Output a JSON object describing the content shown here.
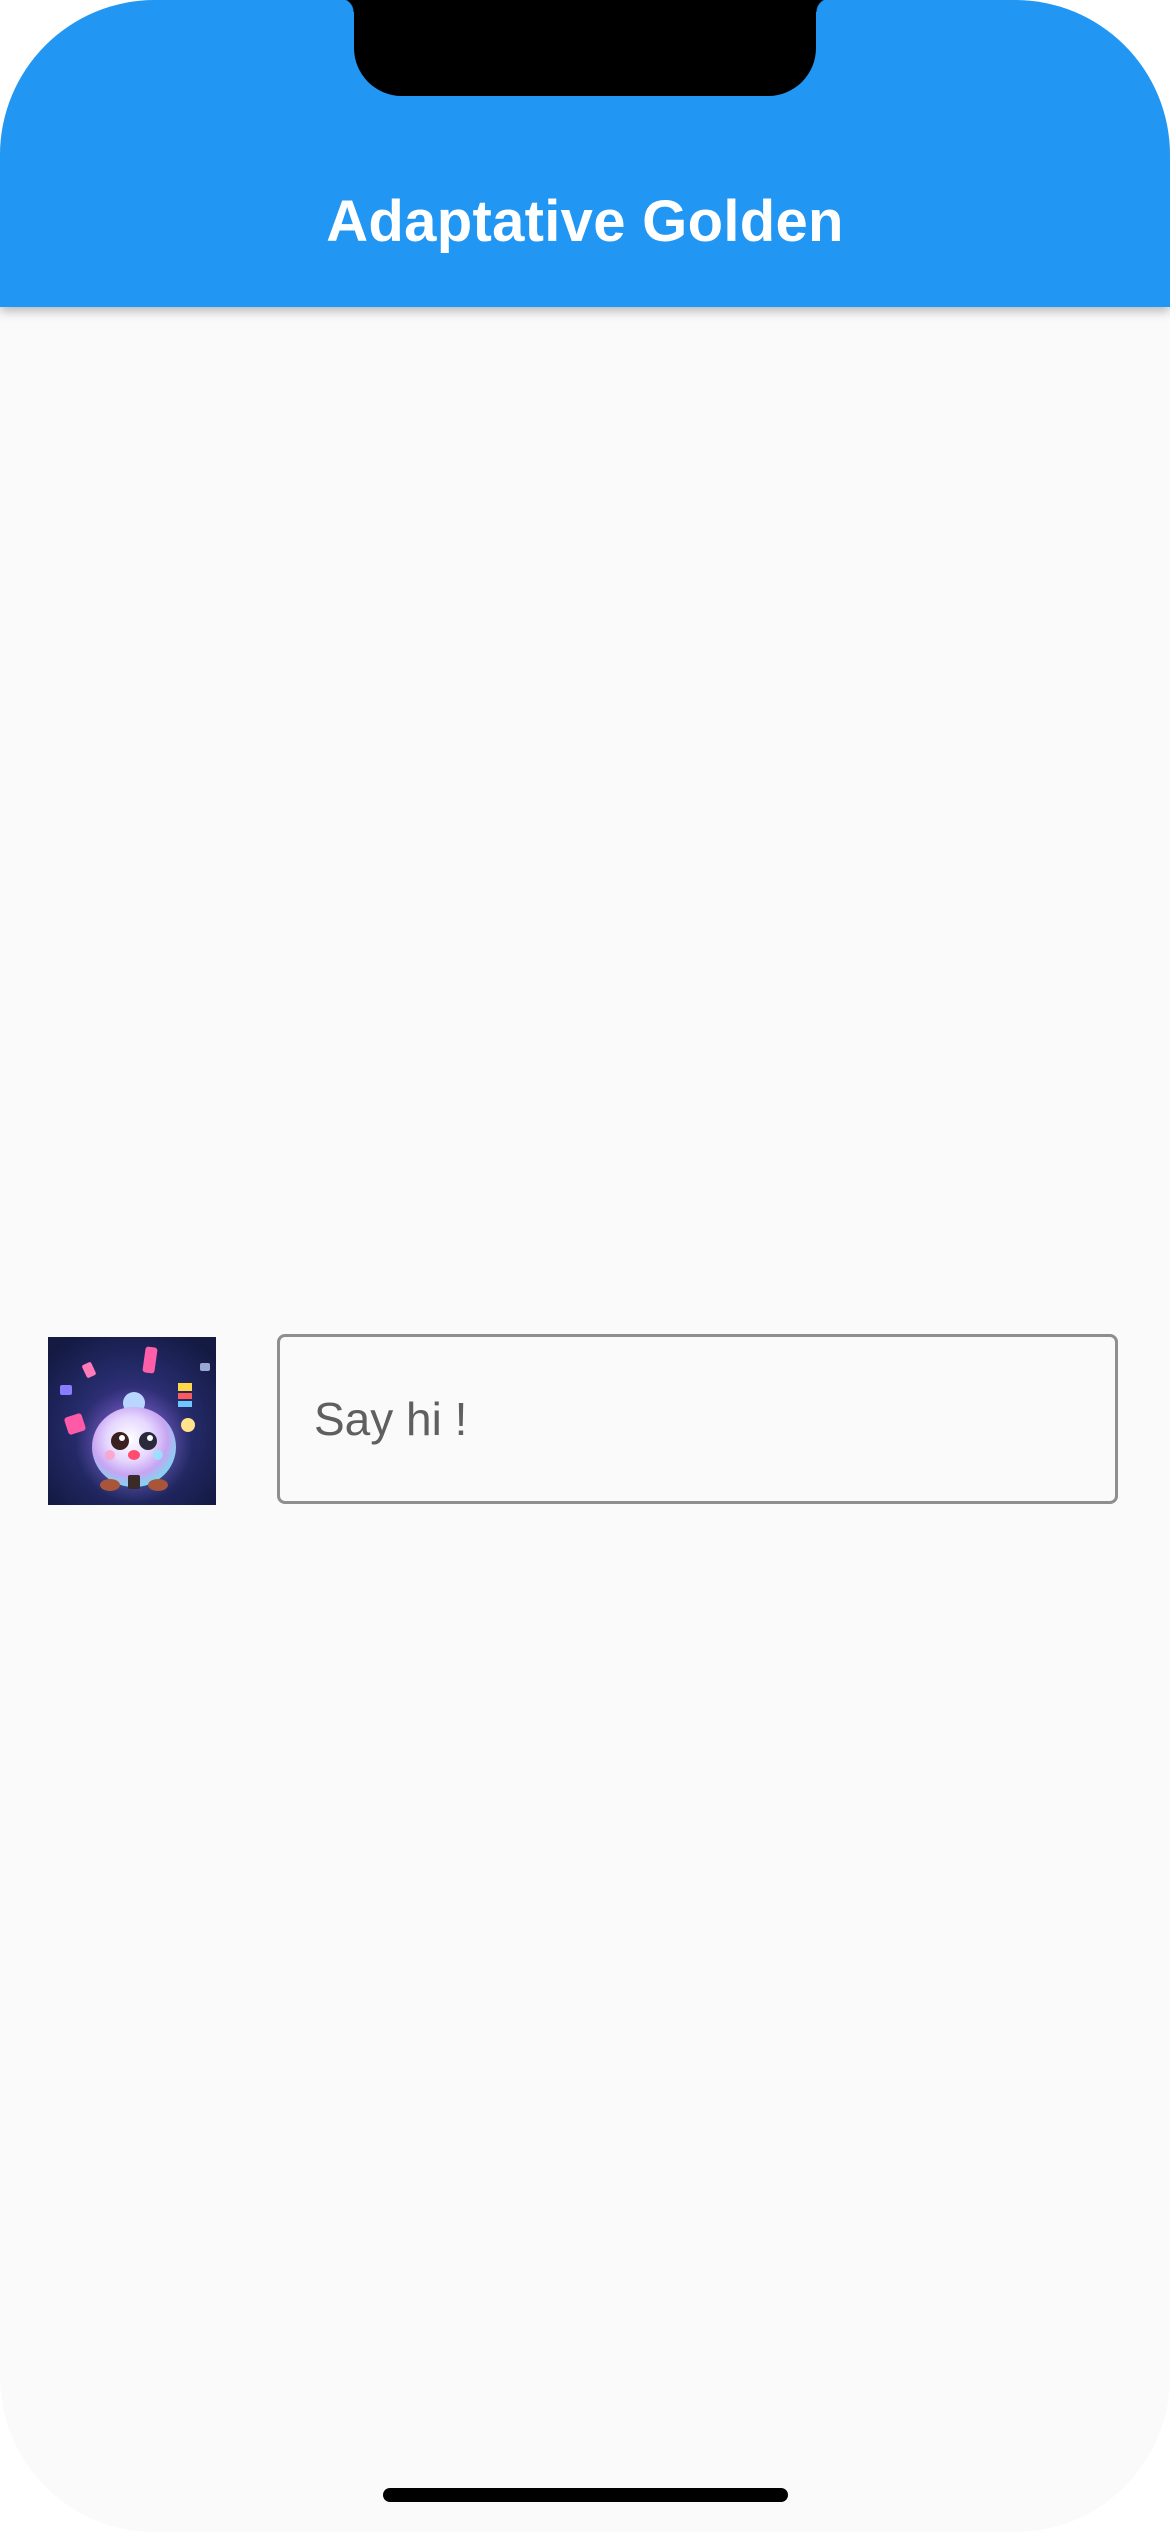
{
  "app_bar": {
    "title": "Adaptative Golden",
    "color": "#2196f3"
  },
  "avatar": {
    "icon": "glowing-character-avatar"
  },
  "message_input": {
    "value": "",
    "placeholder": "Say hi !"
  }
}
